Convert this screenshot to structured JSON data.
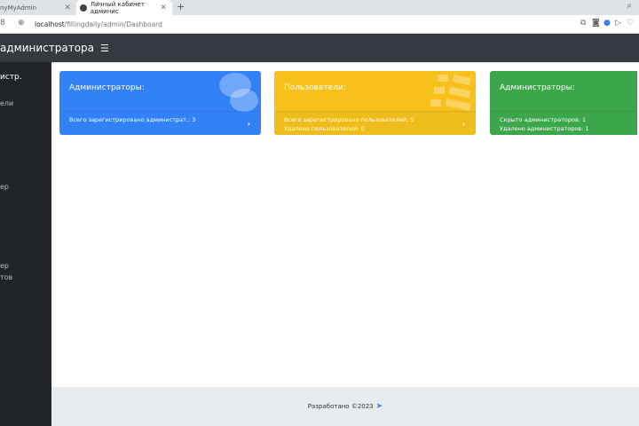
{
  "browser": {
    "tabs": [
      {
        "label": "nyMyAdmin"
      },
      {
        "label": "Личный кабинет админис"
      }
    ],
    "address": {
      "host": "localhost",
      "path": "/fillingdaily/admin/Dashboard"
    }
  },
  "navbar": {
    "title": "администратора",
    "menu_icon": "bars-icon"
  },
  "sidebar": {
    "items": [
      {
        "label": "истр."
      },
      {
        "label": "ели"
      },
      {
        "label": "ер"
      },
      {
        "label": "ер"
      },
      {
        "label": "тов"
      }
    ]
  },
  "cards": [
    {
      "title": "Администраторы:",
      "lines": [
        "Всего зарегистрировано администрат.: 3"
      ],
      "color": "#3381f6",
      "icon": "comments-icon"
    },
    {
      "title": "Пользователи:",
      "lines": [
        "Всего зарегистрировано пользователей: 5",
        "Удалено пользователей: 0"
      ],
      "color": "#f8c01d",
      "icon": "list-icon"
    },
    {
      "title": "Администраторы:",
      "lines": [
        "Скрыто администраторов: 1",
        "Удалено администраторов: 1"
      ],
      "color": "#3ba64a"
    }
  ],
  "footer": {
    "text": "Разработано ©2023"
  }
}
